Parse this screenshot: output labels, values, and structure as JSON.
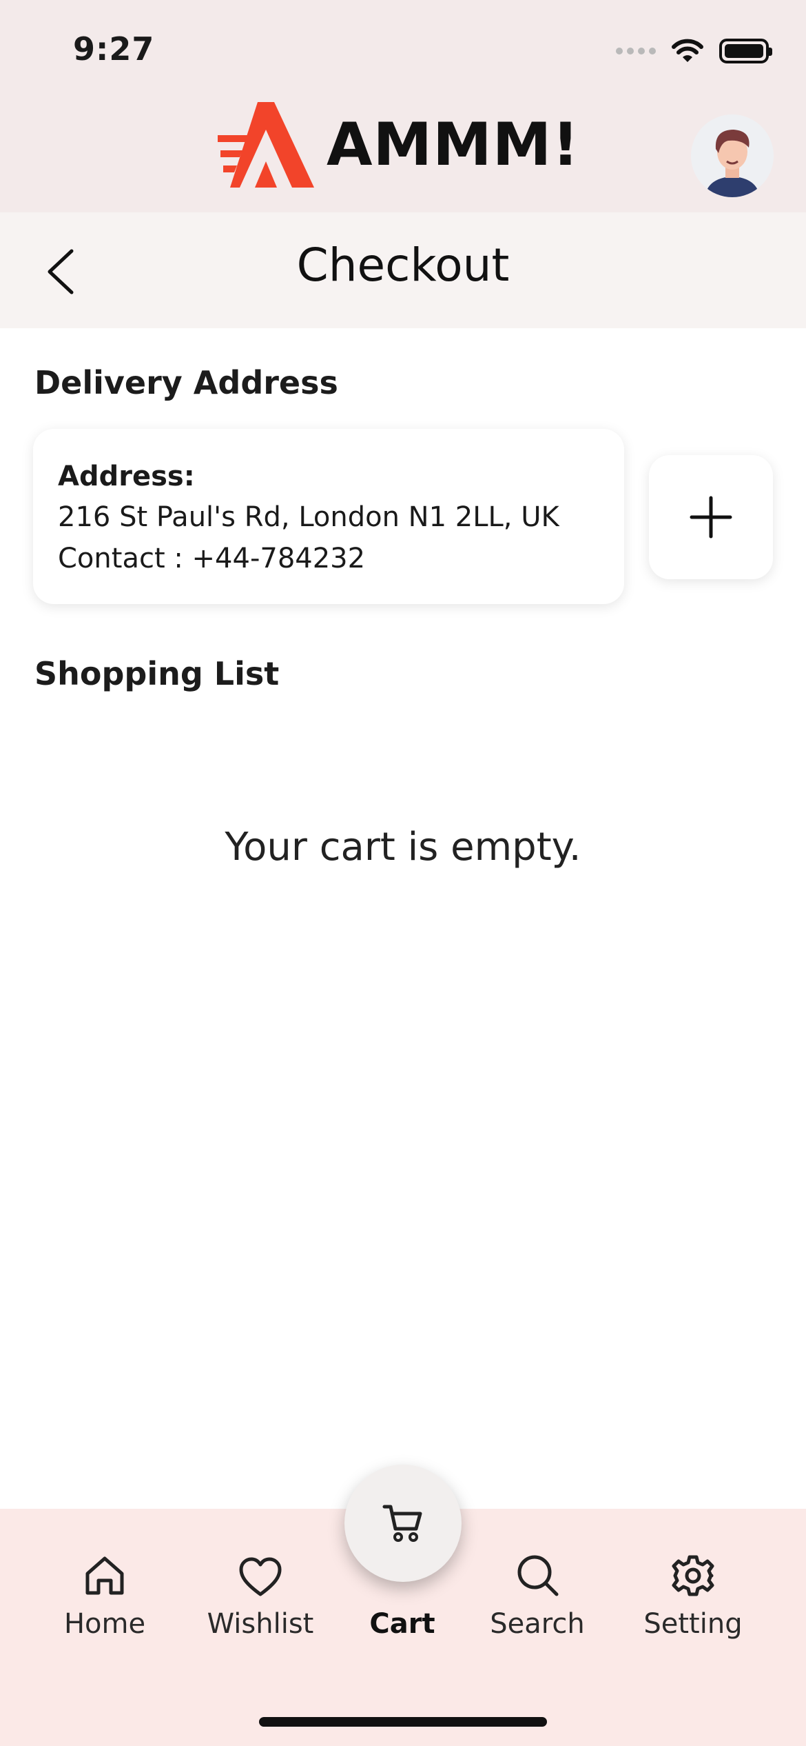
{
  "status_bar": {
    "time": "9:27"
  },
  "header": {
    "brand": "AMMM!",
    "brand_color": "#f2442a"
  },
  "page": {
    "title": "Checkout"
  },
  "delivery": {
    "title": "Delivery Address",
    "address_label": "Address:",
    "address_line": "216 St Paul's Rd, London N1 2LL, UK",
    "contact_line": "Contact : +44-784232"
  },
  "shopping": {
    "title": "Shopping List",
    "empty_message": "Your cart is empty."
  },
  "nav": {
    "items": [
      {
        "label": "Home",
        "icon": "home-icon"
      },
      {
        "label": "Wishlist",
        "icon": "heart-icon"
      },
      {
        "label": "Cart",
        "icon": "cart-icon",
        "active": true
      },
      {
        "label": "Search",
        "icon": "search-icon"
      },
      {
        "label": "Setting",
        "icon": "gear-icon"
      }
    ]
  }
}
